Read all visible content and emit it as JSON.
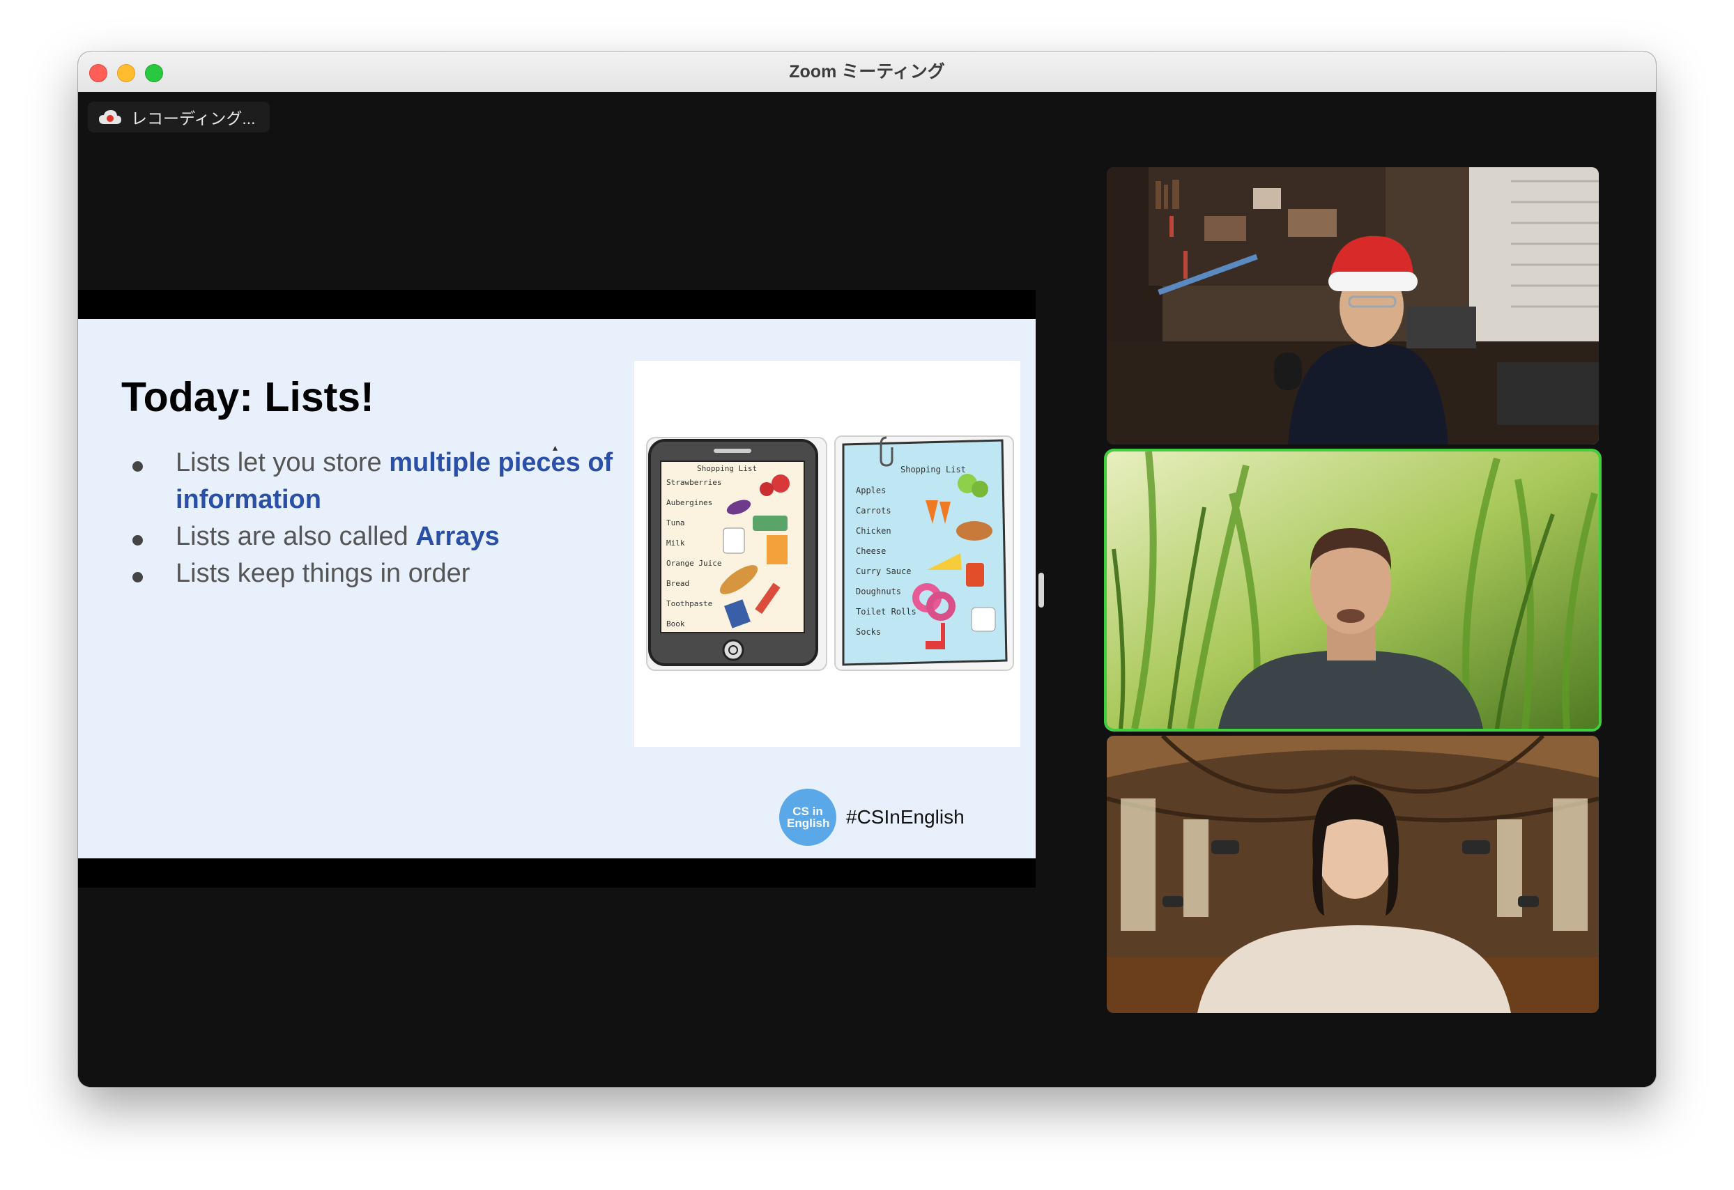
{
  "window": {
    "title": "Zoom ミーティング"
  },
  "recording": {
    "label": "レコーディング..."
  },
  "slide": {
    "title": "Today: Lists!",
    "bullets": [
      {
        "text": "Lists let you store ",
        "highlight": "multiple pieces of information"
      },
      {
        "text": "Lists are also called ",
        "highlight": "Arrays"
      },
      {
        "text": "Lists keep things in order",
        "highlight": ""
      }
    ],
    "tablet_list": {
      "header": "Shopping List",
      "items": [
        "Strawberries",
        "Aubergines",
        "Tuna",
        "Milk",
        "Orange Juice",
        "Bread",
        "Toothpaste",
        "Book"
      ]
    },
    "paper_list": {
      "header": "Shopping List",
      "items": [
        "Apples",
        "Carrots",
        "Chicken",
        "Cheese",
        "Curry Sauce",
        "Doughnuts",
        "Toilet Rolls",
        "Socks"
      ]
    },
    "brand_logo_text": "CS in English",
    "hashtag": "#CSInEnglish"
  },
  "colors": {
    "highlight": "#2a4fa6",
    "active_speaker": "#3fcf3f",
    "slide_bg": "#e8f0fb"
  },
  "participants": [
    {
      "video": "man-santa-hat-study",
      "active": false
    },
    {
      "video": "man-grass-background",
      "active": true
    },
    {
      "video": "woman-library-background",
      "active": false
    }
  ]
}
